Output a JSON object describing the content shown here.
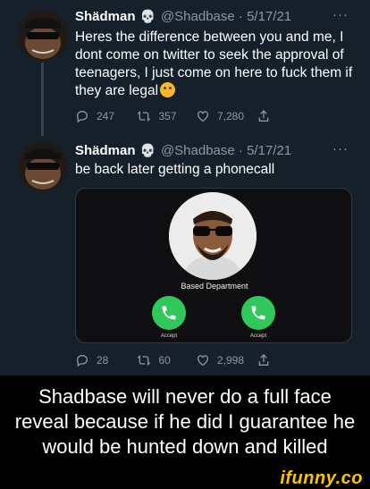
{
  "tweets": [
    {
      "display_name": "Shädman",
      "handle": "@Shadbase",
      "date": "5/17/21",
      "more": "···",
      "text": "Heres the difference between you and me, I dont come on twitter to seek the approval of teenagers, I just come on here to fuck them if they are legal",
      "replies": "247",
      "retweets": "357",
      "likes": "7,280"
    },
    {
      "display_name": "Shädman",
      "handle": "@Shadbase",
      "date": "5/17/21",
      "more": "···",
      "text": "be back later getting a phonecall",
      "replies": "28",
      "retweets": "60",
      "likes": "2,998",
      "media": {
        "caller_name": "Based Department",
        "accept_label_left": "Accept",
        "accept_label_right": "Accept"
      }
    }
  ],
  "caption": "Shadbase will never do a full face reveal because if he did I guarantee he would be hunted down and killed",
  "watermark": "ifunny.co",
  "colors": {
    "background": "#15202b",
    "secondary_text": "#8899a6",
    "accept_green": "#30c85a",
    "watermark_yellow": "#f7c600"
  },
  "icons": [
    "skull-icon",
    "reply-icon",
    "retweet-icon",
    "like-icon",
    "share-icon",
    "phone-icon"
  ]
}
